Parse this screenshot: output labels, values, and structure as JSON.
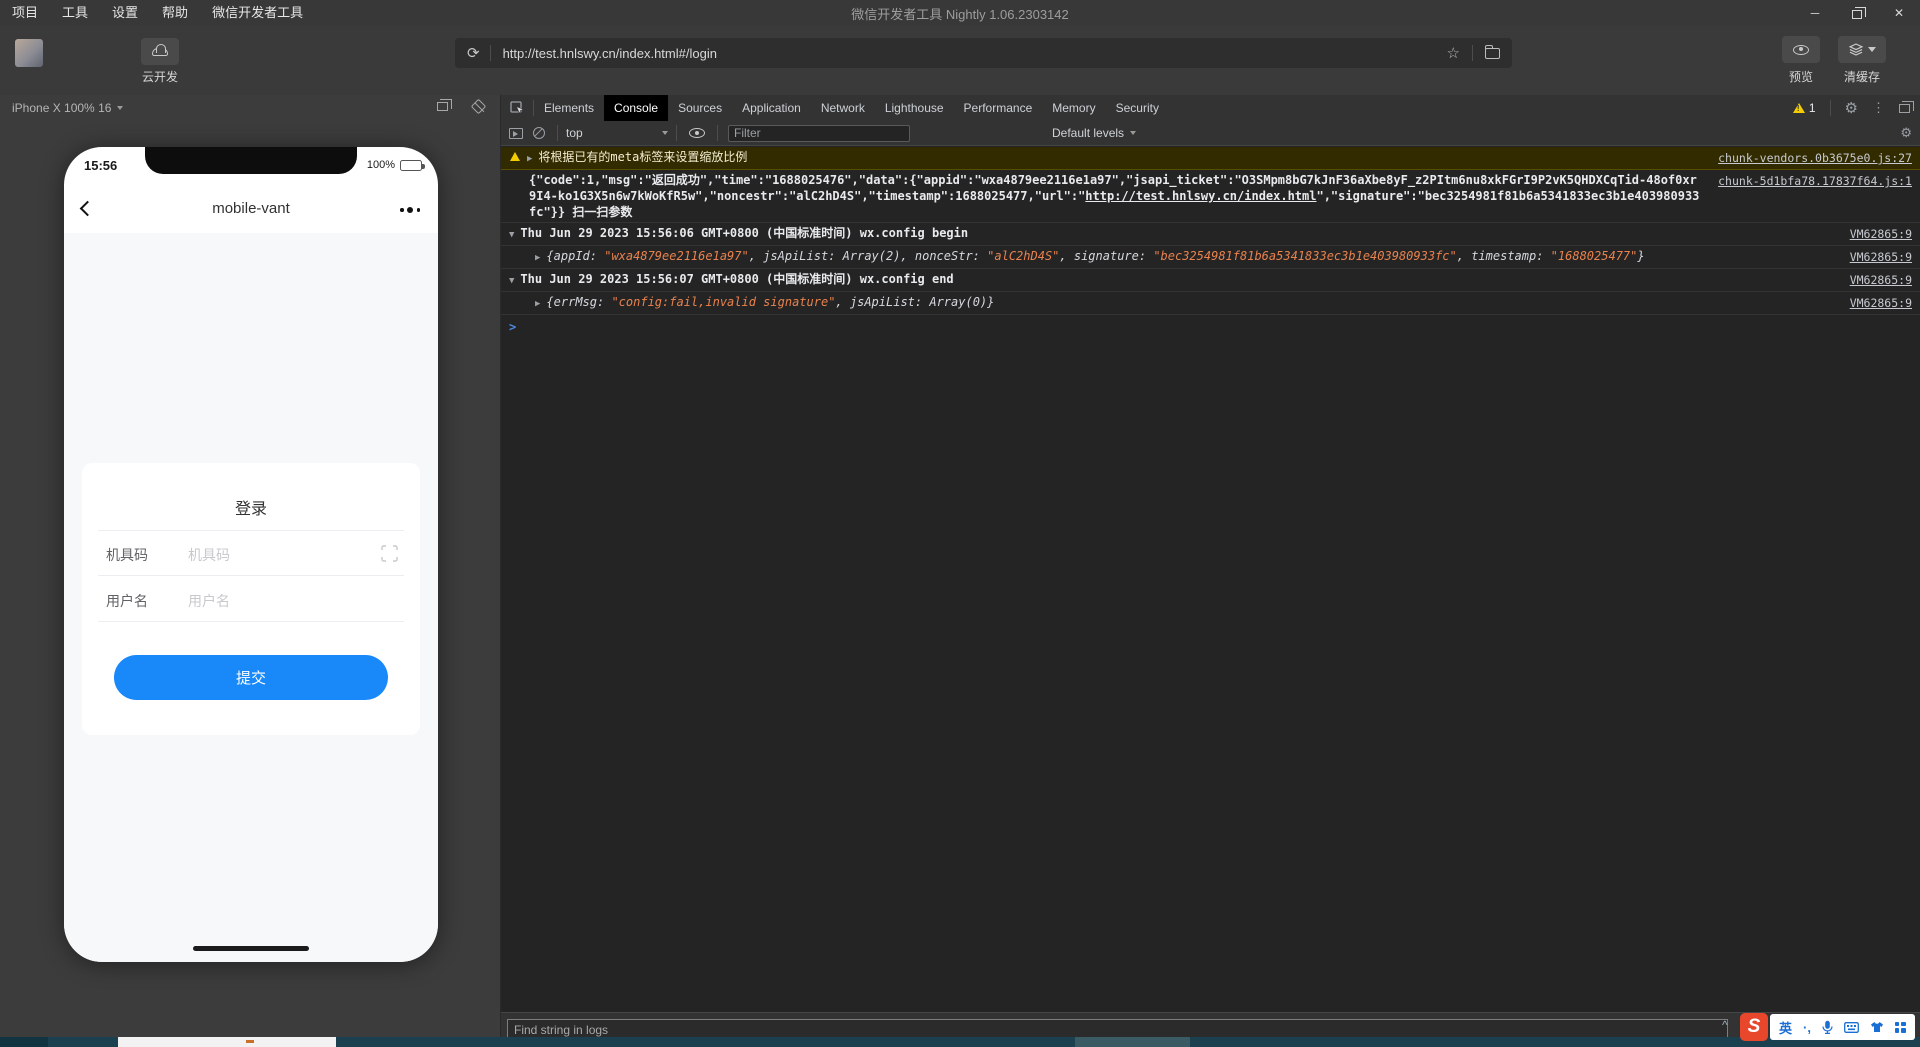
{
  "titlebar": {
    "menu_items": [
      "项目",
      "工具",
      "设置",
      "帮助",
      "微信开发者工具"
    ],
    "title": "微信开发者工具 Nightly 1.06.2303142"
  },
  "toolbar": {
    "cloud_dev_label": "云开发",
    "url": "http://test.hnlswy.cn/index.html#/login",
    "preview_label": "预览",
    "clear_cache_label": "清缓存"
  },
  "simulator": {
    "device_selector": "iPhone X 100% 16",
    "phone": {
      "status_time": "15:56",
      "battery_percent": "100%",
      "nav_title": "mobile-vant",
      "login_form": {
        "title": "登录",
        "fields": [
          {
            "label": "机具码",
            "placeholder": "机具码",
            "scan_icon": true
          },
          {
            "label": "用户名",
            "placeholder": "用户名",
            "scan_icon": false
          }
        ],
        "submit_label": "提交"
      }
    }
  },
  "devtools": {
    "tabs": [
      {
        "label": "Elements",
        "active": false
      },
      {
        "label": "Console",
        "active": true
      },
      {
        "label": "Sources",
        "active": false
      },
      {
        "label": "Application",
        "active": false
      },
      {
        "label": "Network",
        "active": false
      },
      {
        "label": "Lighthouse",
        "active": false
      },
      {
        "label": "Performance",
        "active": false
      },
      {
        "label": "Memory",
        "active": false
      },
      {
        "label": "Security",
        "active": false
      }
    ],
    "warning_count": "1",
    "console_toolbar": {
      "context_selector": "top",
      "filter_placeholder": "Filter",
      "levels_selector": "Default levels"
    },
    "logs": [
      {
        "kind": "warning",
        "icon": "warning",
        "arrow": "▶",
        "segments": [
          {
            "t": "将根据已有的meta标签来设置缩放比例"
          }
        ],
        "source": "chunk-vendors.0b3675e0.js:27"
      },
      {
        "kind": "json",
        "segments": [
          {
            "t": "{\"code\":1,\"msg\":\"返回成功\",\"time\":\"1688025476\",\"data\":{\"appid\":\"wxa4879ee2116e1a97\",\"jsapi_ticket\":\"O3SMpm8bG7kJnF36aXbe8yF_z2PItm6nu8xkFGrI9P2vK5QHDXCqTid-48of0xr9I4-ko1G3X5n6w7kWoKfR5w\",\"noncestr\":\"alC2hD4S\",\"timestamp\":1688025477,\"url\":\""
          },
          {
            "t": "http://test.hnlswy.cn/index.html",
            "cls": "inline-link"
          },
          {
            "t": "\",\"signature\":\"bec3254981f81b6a5341833ec3b1e403980933fc\"}} 扫一扫参数"
          }
        ],
        "source": "chunk-5d1bfa78.17837f64.js:1"
      },
      {
        "kind": "group",
        "arrow": "▼",
        "segments": [
          {
            "t": "Thu Jun 29 2023 15:56:06 GMT+0800 (中国标准时间) wx.config begin"
          }
        ],
        "source": "VM62865:9"
      },
      {
        "kind": "obj",
        "arrow": "▶",
        "segments": [
          {
            "t": "{appId: "
          },
          {
            "t": "\"wxa4879ee2116e1a97\"",
            "cls": "str"
          },
          {
            "t": ", jsApiList: Array(2), nonceStr: "
          },
          {
            "t": "\"alC2hD4S\"",
            "cls": "str"
          },
          {
            "t": ", signature: "
          },
          {
            "t": "\"bec3254981f81b6a5341833ec3b1e403980933fc\"",
            "cls": "str"
          },
          {
            "t": ", timestamp: "
          },
          {
            "t": "\"1688025477\"",
            "cls": "str"
          },
          {
            "t": "}"
          }
        ],
        "source": "VM62865:9"
      },
      {
        "kind": "group",
        "arrow": "▼",
        "segments": [
          {
            "t": "Thu Jun 29 2023 15:56:07 GMT+0800 (中国标准时间) wx.config end"
          }
        ],
        "source": "VM62865:9"
      },
      {
        "kind": "obj",
        "arrow": "▶",
        "segments": [
          {
            "t": "{errMsg: "
          },
          {
            "t": "\"config:fail,invalid signature\"",
            "cls": "str"
          },
          {
            "t": ", jsApiList: Array(0)}"
          }
        ],
        "source": "VM62865:9"
      },
      {
        "kind": "prompt",
        "segments": []
      }
    ],
    "find_placeholder": "Find string in logs"
  },
  "ime_bar": {
    "logo_letter": "S",
    "mode_label": "英",
    "punct_label": "·,"
  },
  "colors": {
    "accent_blue": "#1989fa",
    "warning_yellow": "#f3cd00",
    "warning_row_bg": "#332b00",
    "console_string_orange": "#e8824e",
    "console_bg": "#242424",
    "chrome_dark_bg": "#3c3c3c",
    "ime_red": "#e8472b"
  }
}
